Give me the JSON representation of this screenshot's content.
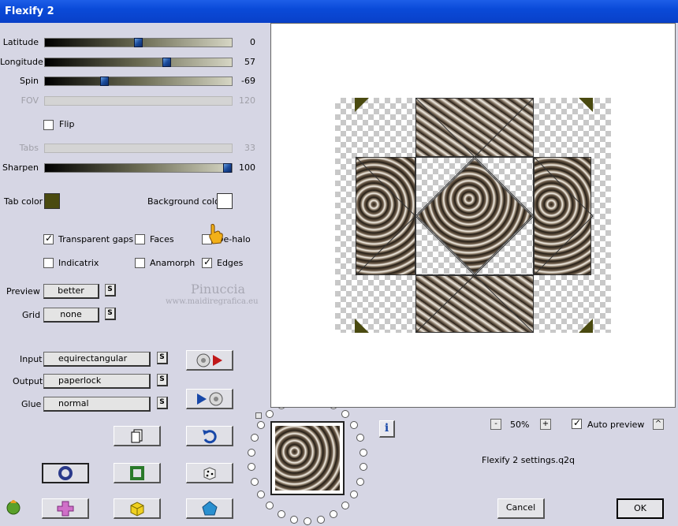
{
  "window": {
    "title": "Flexify 2"
  },
  "sliders": [
    {
      "label": "Latitude",
      "value": "0",
      "fraction": 0.5,
      "enabled": true
    },
    {
      "label": "Longitude",
      "value": "57",
      "fraction": 0.66,
      "enabled": true
    },
    {
      "label": "Spin",
      "value": "-69",
      "fraction": 0.31,
      "enabled": true
    },
    {
      "label": "FOV",
      "value": "120",
      "fraction": null,
      "enabled": false
    },
    {
      "label": "Tabs",
      "value": "33",
      "fraction": null,
      "enabled": false
    },
    {
      "label": "Sharpen",
      "value": "100",
      "fraction": 1.0,
      "enabled": true
    }
  ],
  "flip": {
    "label": "Flip",
    "checked": false
  },
  "tab_color": {
    "label": "Tab color",
    "color": "#4a4a10"
  },
  "background_color": {
    "label": "Background color",
    "color": "#ffffff"
  },
  "options": {
    "transparent_gaps": {
      "label": "Transparent gaps",
      "checked": true
    },
    "faces": {
      "label": "Faces",
      "checked": false
    },
    "de_halo": {
      "label": "De-halo",
      "checked": false
    },
    "indicatrix": {
      "label": "Indicatrix",
      "checked": false
    },
    "anamorph": {
      "label": "Anamorph",
      "checked": false
    },
    "edges": {
      "label": "Edges",
      "checked": true
    }
  },
  "preview": {
    "label": "Preview",
    "value": "better"
  },
  "grid": {
    "label": "Grid",
    "value": "none"
  },
  "input": {
    "label": "Input",
    "value": "equirectangular"
  },
  "output": {
    "label": "Output",
    "value": "paperlock"
  },
  "glue": {
    "label": "Glue",
    "value": "normal"
  },
  "s_label": "S",
  "watermark": {
    "name": "Pinuccia",
    "url": "www.maidiregrafica.eu"
  },
  "zoom": {
    "minus": "-",
    "value": "50%",
    "plus": "+"
  },
  "auto_preview": {
    "label": "Auto preview",
    "checked": true
  },
  "settings_file": "Flexify 2 settings.q2q",
  "info_label": "i",
  "expand_label": "^",
  "cancel_label": "Cancel",
  "ok_label": "OK"
}
